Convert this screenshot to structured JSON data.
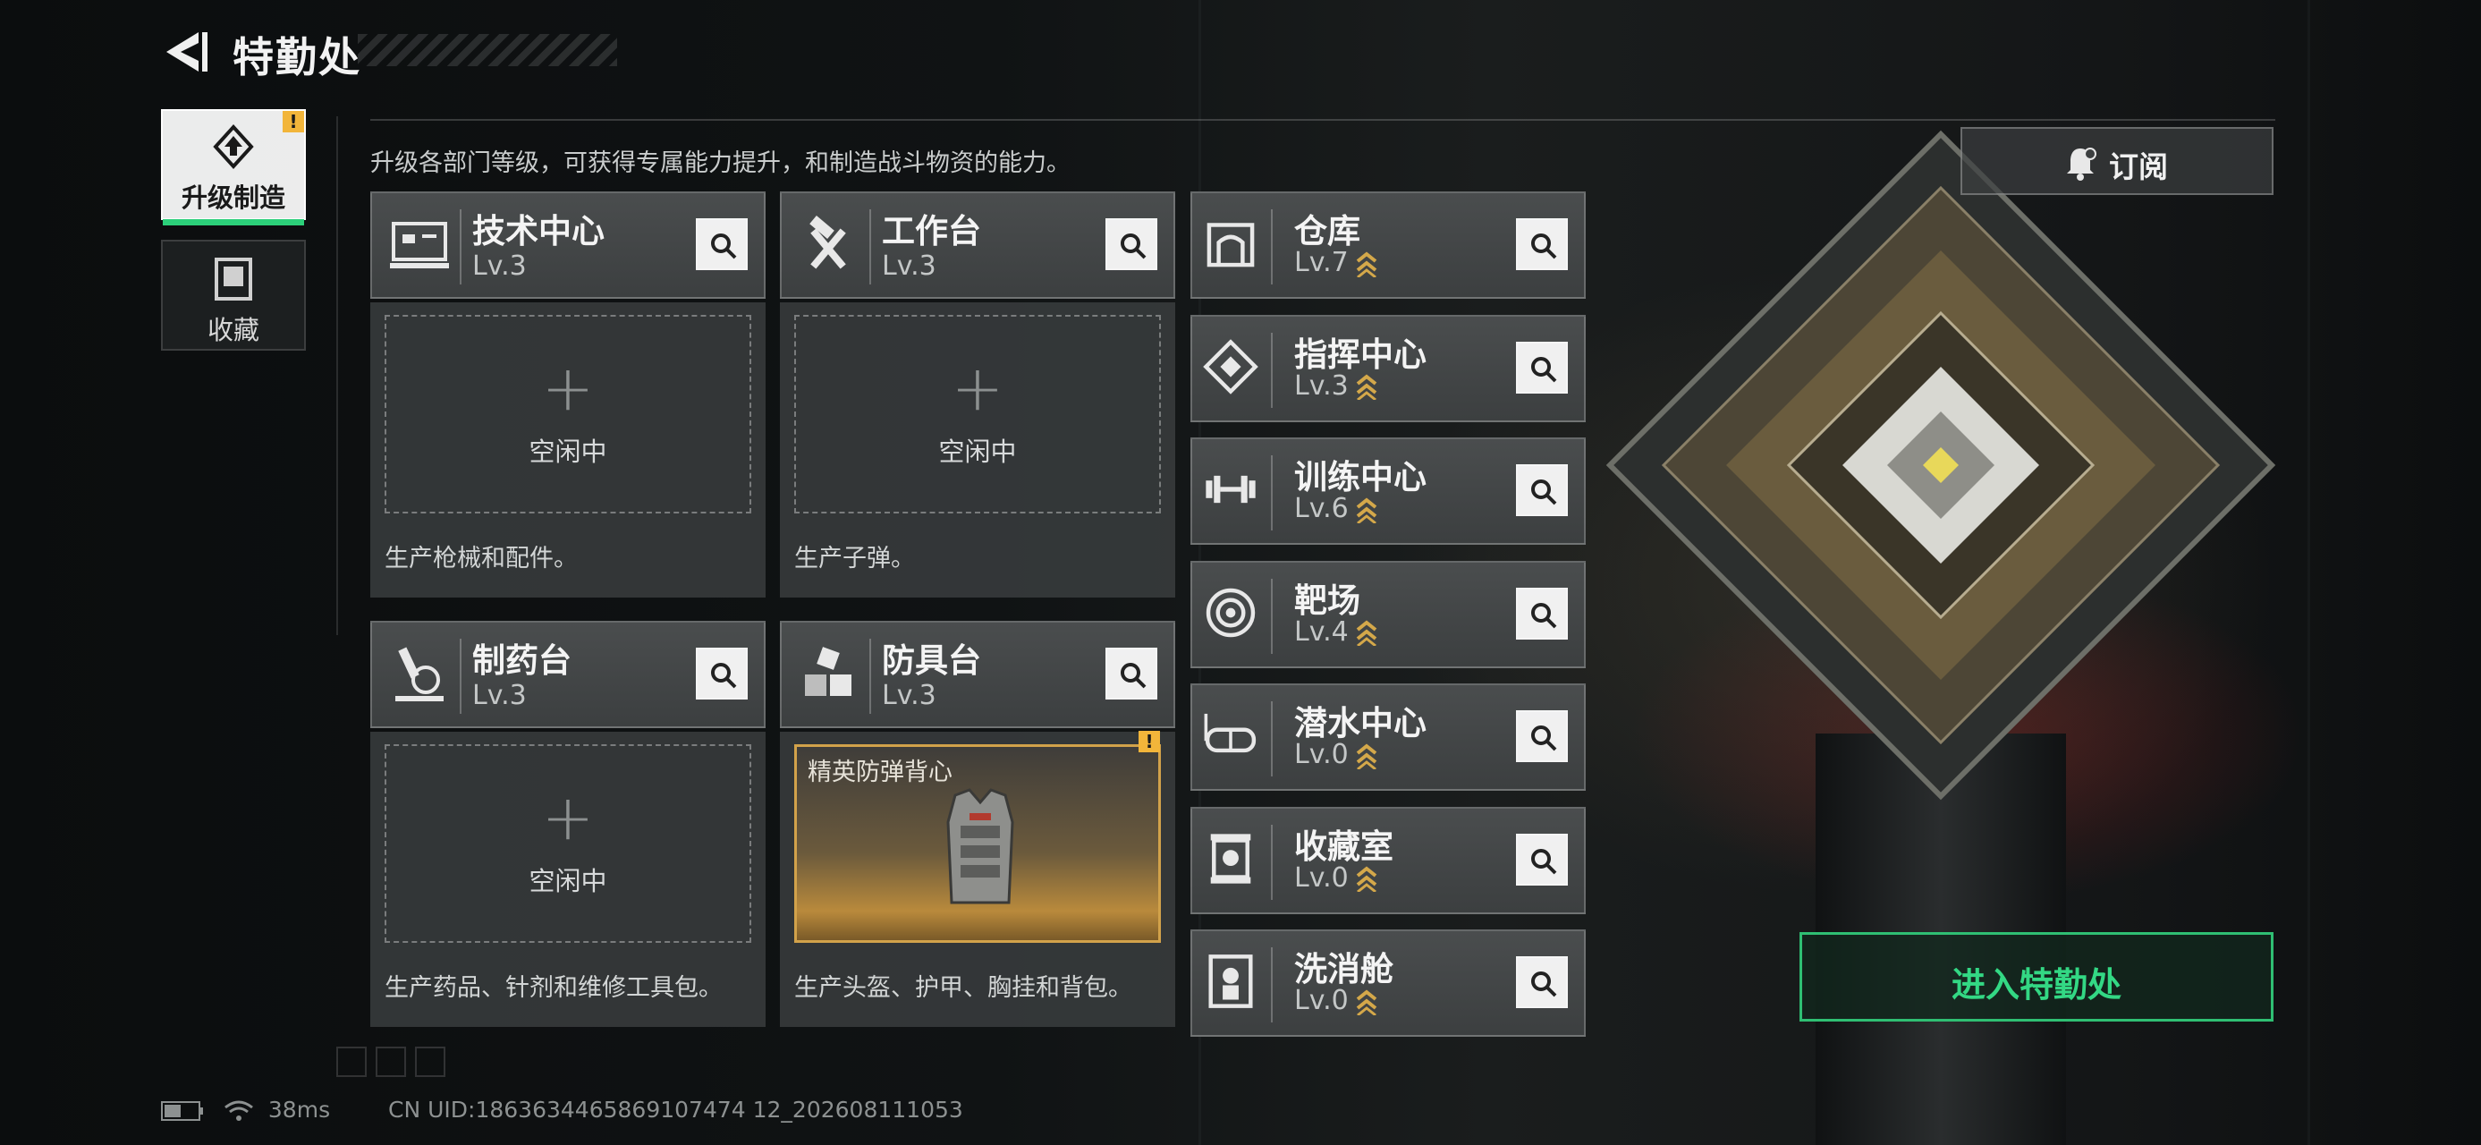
{
  "header": {
    "title": "特勤处",
    "back_icon": "back-arrow-icon"
  },
  "side_tabs": [
    {
      "label": "升级制造",
      "icon": "upgrade-icon",
      "badge": "!",
      "active": true
    },
    {
      "label": "收藏",
      "icon": "collection-icon",
      "active": false
    }
  ],
  "subtitle": "升级各部门等级，可获得专属能力提升，和制造战斗物资的能力。",
  "crafting": [
    {
      "name": "技术中心",
      "level": "Lv.3",
      "icon": "tech-center-icon",
      "slot": {
        "plus": "+",
        "status": "空闲中"
      },
      "desc": "生产枪械和配件。"
    },
    {
      "name": "工作台",
      "level": "Lv.3",
      "icon": "workbench-icon",
      "slot": {
        "plus": "+",
        "status": "空闲中"
      },
      "desc": "生产子弹。"
    },
    {
      "name": "制药台",
      "level": "Lv.3",
      "icon": "pharmacy-icon",
      "slot": {
        "plus": "+",
        "status": "空闲中"
      },
      "desc": "生产药品、针剂和维修工具包。"
    },
    {
      "name": "防具台",
      "level": "Lv.3",
      "icon": "armor-bench-icon",
      "slot": {
        "item_name": "精英防弹背心",
        "badge": "!"
      },
      "desc": "生产头盔、护甲、胸挂和背包。"
    }
  ],
  "facilities": [
    {
      "name": "仓库",
      "level": "Lv.7",
      "icon": "warehouse-icon"
    },
    {
      "name": "指挥中心",
      "level": "Lv.3",
      "icon": "command-center-icon"
    },
    {
      "name": "训练中心",
      "level": "Lv.6",
      "icon": "training-center-icon"
    },
    {
      "name": "靶场",
      "level": "Lv.4",
      "icon": "shooting-range-icon"
    },
    {
      "name": "潜水中心",
      "level": "Lv.0",
      "icon": "diving-center-icon"
    },
    {
      "name": "收藏室",
      "level": "Lv.0",
      "icon": "collection-room-icon"
    },
    {
      "name": "洗消舱",
      "level": "Lv.0",
      "icon": "decontamination-icon"
    }
  ],
  "subscribe_label": "订阅",
  "enter_label": "进入特勤处",
  "status": {
    "ping": "38ms",
    "uid": "CN UID:1863634465869107474 12_202608111053"
  },
  "colors": {
    "accent_green": "#2fbf73",
    "warning": "#f2b53a",
    "item_gold": "#d2a24a"
  }
}
